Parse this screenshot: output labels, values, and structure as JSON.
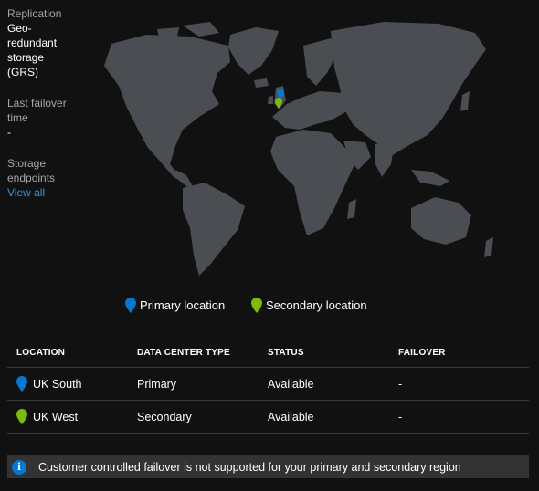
{
  "replication": {
    "label": "Replication",
    "value_lines": [
      "Geo-",
      "redundant",
      "storage",
      "(GRS)"
    ]
  },
  "last_failover": {
    "label_lines": [
      "Last failover",
      "time"
    ],
    "value": "-"
  },
  "storage_endpoints": {
    "label_lines": [
      "Storage",
      "endpoints"
    ],
    "link": "View all"
  },
  "legend": {
    "primary": "Primary location",
    "secondary": "Secondary location"
  },
  "colors": {
    "primary_pin": "#0078d4",
    "secondary_pin": "#7fba00",
    "land": "#4a4d52",
    "background": "#111111",
    "link": "#3a96dd"
  },
  "table": {
    "headers": [
      "LOCATION",
      "DATA CENTER TYPE",
      "STATUS",
      "FAILOVER"
    ],
    "rows": [
      {
        "location": "UK South",
        "type": "Primary",
        "status": "Available",
        "failover": "-",
        "pin": "primary"
      },
      {
        "location": "UK West",
        "type": "Secondary",
        "status": "Available",
        "failover": "-",
        "pin": "secondary"
      }
    ]
  },
  "notice": {
    "icon": "info-icon",
    "text": "Customer controlled failover is not supported for your primary and secondary region"
  }
}
